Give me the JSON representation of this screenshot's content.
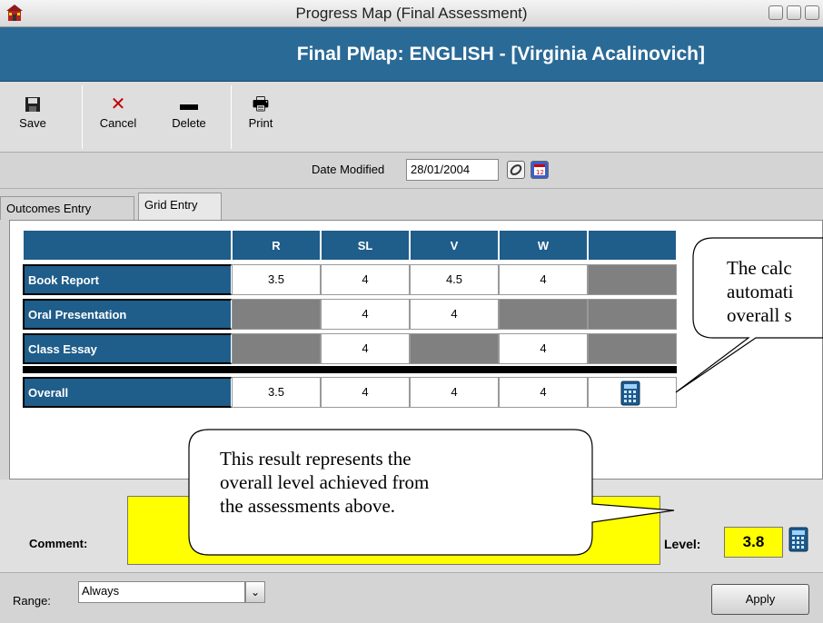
{
  "window": {
    "title": "Progress Map (Final Assessment)"
  },
  "header": {
    "title": "Final PMap: ENGLISH - [Virginia Acalinovich]"
  },
  "toolbar": {
    "buttons": [
      {
        "label": "Save",
        "icon": "save-icon"
      },
      {
        "label": "Cancel",
        "icon": "cancel-icon"
      },
      {
        "label": "Delete",
        "icon": "delete-icon"
      },
      {
        "label": "Print",
        "icon": "print-icon"
      }
    ]
  },
  "date": {
    "label": "Date Modified",
    "value": "28/01/2004"
  },
  "tabs": [
    {
      "label": "Outcomes Entry"
    },
    {
      "label": "Grid Entry",
      "active": true
    }
  ],
  "grid": {
    "columns": [
      "R",
      "SL",
      "V",
      "W",
      ""
    ],
    "rows": [
      {
        "label": "Book Report",
        "values": [
          "3.5",
          "4",
          "4.5",
          "4"
        ]
      },
      {
        "label": "Oral Presentation",
        "values": [
          null,
          "4",
          "4",
          null
        ]
      },
      {
        "label": "Class Essay",
        "values": [
          null,
          "4",
          null,
          "4"
        ]
      }
    ],
    "overall": {
      "label": "Overall",
      "values": [
        "3.5",
        "4",
        "4",
        "4"
      ]
    }
  },
  "callouts": {
    "calculator": [
      "The calc",
      "automati",
      "overall s"
    ],
    "level": [
      "This result represents the",
      "overall level achieved from",
      "the assessments above."
    ]
  },
  "comment": {
    "label": "Comment:",
    "value": ""
  },
  "level": {
    "label": "Level:",
    "value": "3.8"
  },
  "range": {
    "label": "Range:",
    "value": "Always"
  },
  "apply": {
    "label": "Apply"
  },
  "colors": {
    "header": "#2a6a96",
    "grid_header": "#1f5d8a",
    "highlight": "#ffff00",
    "disabled_cell": "#808080"
  }
}
